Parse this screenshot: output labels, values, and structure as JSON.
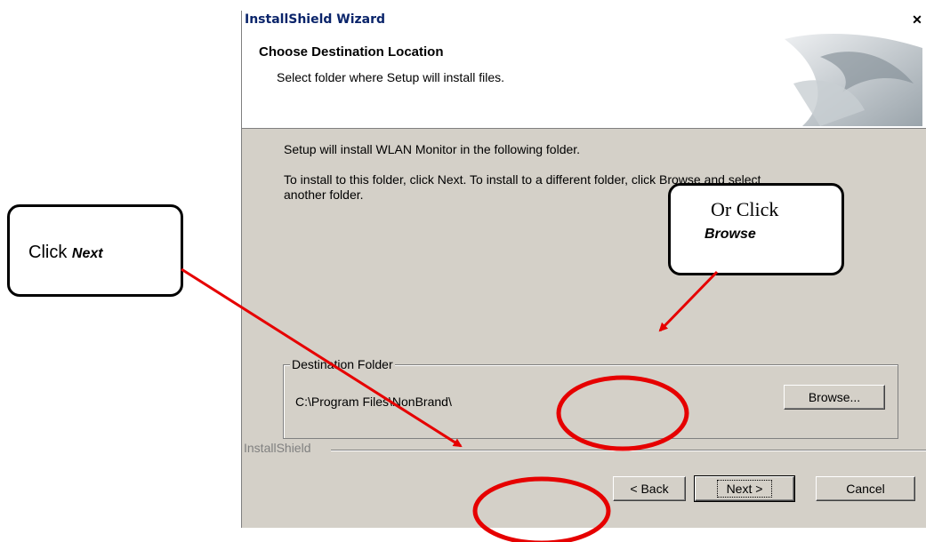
{
  "window": {
    "title": "InstallShield Wizard",
    "close_glyph": "✕"
  },
  "header": {
    "title": "Choose Destination Location",
    "subtitle": "Select folder where Setup will install files."
  },
  "body": {
    "line1": "Setup will install WLAN Monitor in the following folder.",
    "line2a": "To install to this folder, click Next. To install to a different folder, click Browse and select",
    "line2b": "another folder."
  },
  "destination": {
    "group_label": "Destination Folder",
    "path": "C:\\Program Files\\NonBrand\\",
    "browse_label": "Browse..."
  },
  "footer": {
    "brand_label": "InstallShield",
    "back_label": "< Back",
    "next_label": "Next >",
    "cancel_label": "Cancel"
  },
  "annotations": {
    "next_prefix": "Click ",
    "next_word": "Next",
    "browse_prefix": "Or Click",
    "browse_word": "Browse"
  },
  "colors": {
    "dialog_bg": "#d4d0c8",
    "title_text": "#0a246a",
    "annotation_red": "#e60000"
  }
}
